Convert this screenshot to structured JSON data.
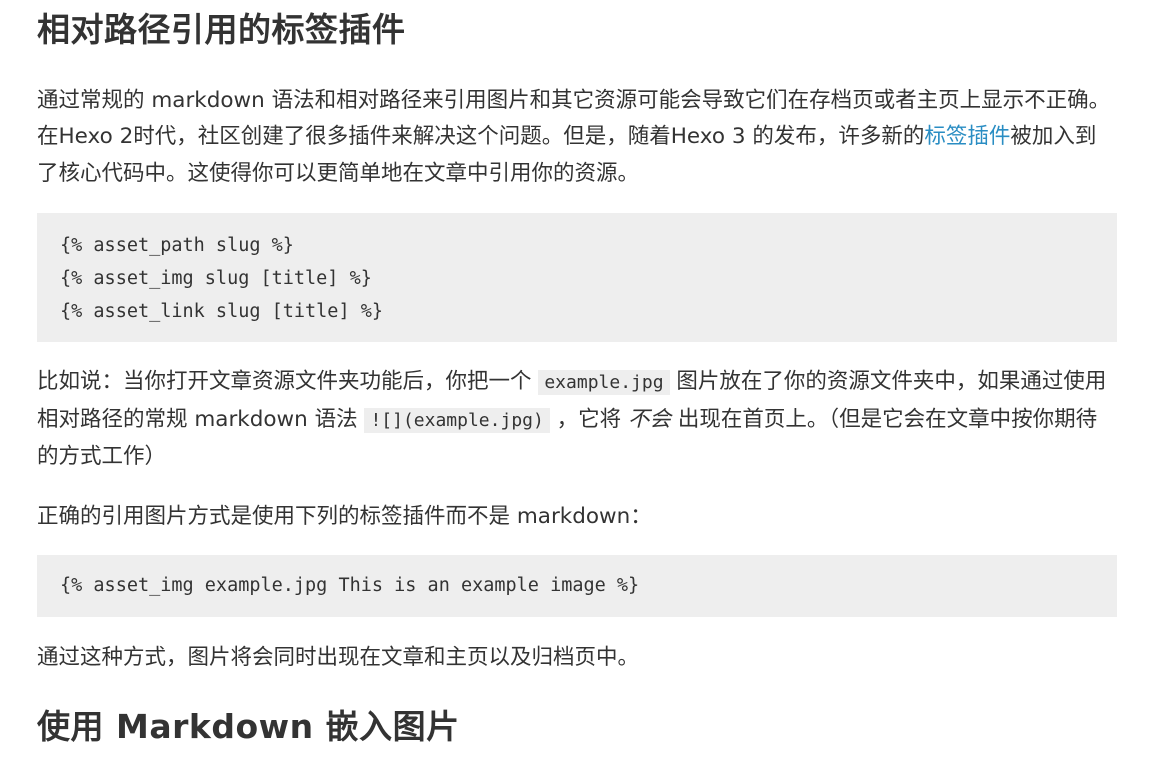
{
  "section1": {
    "heading": "相对路径引用的标签插件",
    "intro_part1": "通过常规的 markdown 语法和相对路径来引用图片和其它资源可能会导致它们在存档页或者主页上显示不正确。在Hexo 2时代，社区创建了很多插件来解决这个问题。但是，随着Hexo 3 的发布，许多新的",
    "intro_link": "标签插件",
    "intro_part2": "被加入到了核心代码中。这使得你可以更简单地在文章中引用你的资源。",
    "code_block_1": [
      "{% asset_path slug %}",
      "{% asset_img slug [title] %}",
      "{% asset_link slug [title] %}"
    ],
    "para2": {
      "text1": "比如说：当你打开文章资源文件夹功能后，你把一个 ",
      "code1": "example.jpg",
      "text2": " 图片放在了你的资源文件夹中，如果通过使用相对路径的常规 markdown 语法 ",
      "code2": "![](example.jpg)",
      "text3": " ，它将 ",
      "emphasis": "不会",
      "text4": " 出现在首页上。（但是它会在文章中按你期待的方式工作）"
    },
    "para3": "正确的引用图片方式是使用下列的标签插件而不是 markdown：",
    "code_block_2": "{% asset_img example.jpg This is an example image %}",
    "para4": "通过这种方式，图片将会同时出现在文章和主页以及归档页中。"
  },
  "section2": {
    "heading": "使用 Markdown 嵌入图片"
  },
  "colors": {
    "text": "#333333",
    "link": "#2a8dc3",
    "code_background": "#eeeeee"
  }
}
